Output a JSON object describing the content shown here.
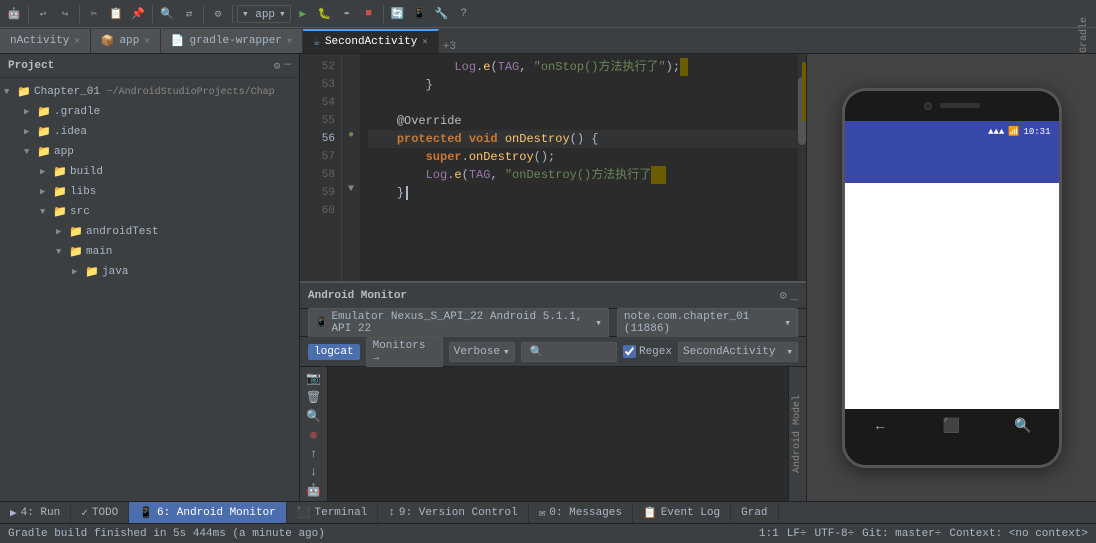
{
  "toolbar": {
    "app_label": "▾ app",
    "run_icon": "▶",
    "debug_icon": "🐛",
    "stop_icon": "■"
  },
  "tabs": [
    {
      "label": "nActivity",
      "active": false
    },
    {
      "label": "app",
      "active": false
    },
    {
      "label": "gradle-wrapper",
      "active": false
    },
    {
      "label": "SecondActivity",
      "active": true
    }
  ],
  "sidebar": {
    "title": "Project",
    "tree": [
      {
        "indent": 0,
        "expanded": true,
        "type": "module",
        "label": "Chapter_01",
        "suffix": "~/AndroidStudioProjects/Chap"
      },
      {
        "indent": 1,
        "expanded": false,
        "type": "folder",
        "label": ".gradle"
      },
      {
        "indent": 1,
        "expanded": false,
        "type": "folder",
        "label": ".idea"
      },
      {
        "indent": 1,
        "expanded": true,
        "type": "folder",
        "label": "app"
      },
      {
        "indent": 2,
        "expanded": false,
        "type": "folder",
        "label": "build"
      },
      {
        "indent": 2,
        "expanded": false,
        "type": "folder",
        "label": "libs"
      },
      {
        "indent": 2,
        "expanded": true,
        "type": "folder",
        "label": "src"
      },
      {
        "indent": 3,
        "expanded": false,
        "type": "folder",
        "label": "androidTest"
      },
      {
        "indent": 3,
        "expanded": true,
        "type": "folder",
        "label": "main"
      },
      {
        "indent": 4,
        "expanded": false,
        "type": "folder",
        "label": "java"
      }
    ]
  },
  "code": {
    "lines": [
      {
        "num": 52,
        "content": "            Log.e(TAG, \"onStop()方法执行了\");",
        "highlight": false
      },
      {
        "num": 53,
        "content": "        }",
        "highlight": false
      },
      {
        "num": 54,
        "content": "",
        "highlight": false
      },
      {
        "num": 55,
        "content": "    @Override",
        "highlight": false
      },
      {
        "num": 56,
        "content": "    protected void onDestroy() {",
        "highlight": true
      },
      {
        "num": 57,
        "content": "        super.onDestroy();",
        "highlight": false
      },
      {
        "num": 58,
        "content": "        Log.e(TAG, \"onDestroy()方法执行了\"",
        "highlight": false
      },
      {
        "num": 59,
        "content": "    }",
        "highlight": false
      },
      {
        "num": 60,
        "content": "",
        "highlight": false
      }
    ]
  },
  "monitor_panel": {
    "title": "Android Monitor",
    "device": "Emulator Nexus_S_API_22 Android 5.1.1, API 22",
    "app": "note.com.chapter_01 (11886)",
    "logcat_label": "logcat",
    "monitors_label": "Monitors →",
    "verbose_label": "Verbose",
    "regex_label": "Regex",
    "activity_label": "SecondActivity"
  },
  "bottom_tabs": [
    {
      "label": "4: Run",
      "active": false,
      "icon": "▶"
    },
    {
      "label": "TODO",
      "active": false,
      "icon": "✓"
    },
    {
      "label": "6: Android Monitor",
      "active": true,
      "icon": "📱"
    },
    {
      "label": "Terminal",
      "active": false,
      "icon": "⬛"
    },
    {
      "label": "9: Version Control",
      "active": false,
      "icon": "↕"
    },
    {
      "label": "0: Messages",
      "active": false,
      "icon": "✉"
    },
    {
      "label": "Event Log",
      "active": false,
      "icon": "📋"
    },
    {
      "label": "Grad",
      "active": false,
      "icon": "🔧"
    }
  ],
  "status_bar": {
    "build_text": "Gradle build finished in 5s 444ms (a minute ago)",
    "position": "1:1",
    "line_separator": "LF÷",
    "encoding": "UTF-8÷",
    "git": "Git: master÷",
    "context": "Context: <no context>"
  },
  "phone": {
    "time": "10:31",
    "signal": "▲▲▲",
    "app_bar_title": ""
  },
  "side_labels": {
    "gradle": "Gradle",
    "android_model": "Android Model"
  }
}
